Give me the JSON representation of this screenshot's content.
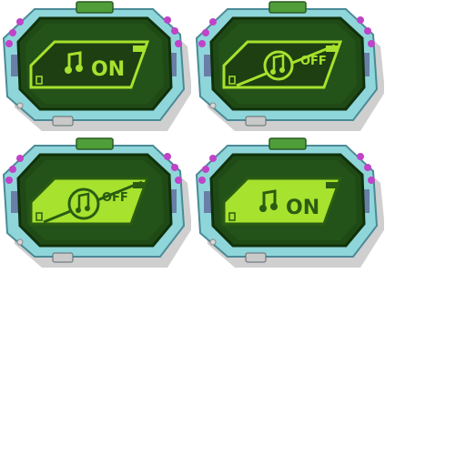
{
  "sprites": [
    {
      "id": "music-toggle-on-normal",
      "state_label": "ON",
      "icon": "music-note-icon",
      "panel": "dark"
    },
    {
      "id": "music-toggle-off-normal",
      "state_label": "OFF",
      "icon": "music-note-icon",
      "panel": "dark"
    },
    {
      "id": "music-toggle-off-pressed",
      "state_label": "OFF",
      "icon": "music-note-icon",
      "panel": "light"
    },
    {
      "id": "music-toggle-on-pressed",
      "state_label": "ON",
      "icon": "music-note-icon",
      "panel": "light"
    }
  ],
  "colors": {
    "frame": "#8fd6db",
    "frame_dark": "#5aa7b4",
    "screen": "#1f4a16",
    "screen_mid": "#2f6a1e",
    "lime": "#a6e22e",
    "lime_dark": "#2a5c12",
    "magenta": "#c043c8",
    "white": "#ffffff"
  }
}
